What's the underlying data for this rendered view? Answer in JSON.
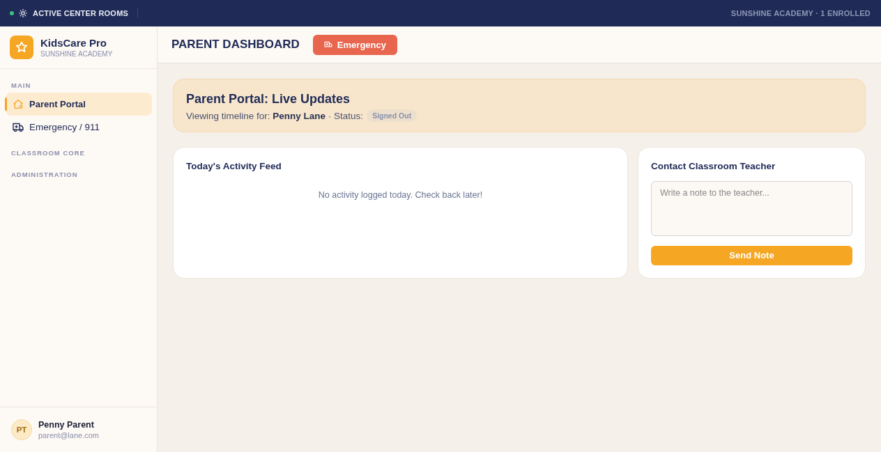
{
  "top_bar": {
    "live": true,
    "label": "ACTIVE CENTER ROOMS",
    "summary": "SUNSHINE ACADEMY · 1 ENROLLED"
  },
  "sidebar": {
    "brand": {
      "name": "KidsCare Pro",
      "subtitle": "SUNSHINE ACADEMY"
    },
    "sections": [
      {
        "title": "MAIN",
        "items": [
          {
            "label": "Parent Portal",
            "selected": true
          },
          {
            "label": "Emergency / 911",
            "selected": false
          }
        ]
      },
      {
        "title": "CLASSROOM CORE"
      },
      {
        "title": "ADMINISTRATION"
      }
    ],
    "user": {
      "initials": "PT",
      "name": "Penny Parent",
      "email": "parent@lane.com"
    }
  },
  "header": {
    "title": "PARENT DASHBOARD",
    "emergency_button": "Emergency"
  },
  "banner": {
    "title": "Parent Portal: Live Updates",
    "text": "Viewing timeline for: **Penny Lane** · Status:",
    "status": "Signed Out"
  },
  "activity_feed": {
    "title": "Today's Activity Feed",
    "empty_message": "No activity logged today. Check back later!"
  },
  "contact_teacher": {
    "title": "Contact Classroom Teacher",
    "placeholder": "Write a note to the teacher...",
    "button": "Send Note"
  }
}
